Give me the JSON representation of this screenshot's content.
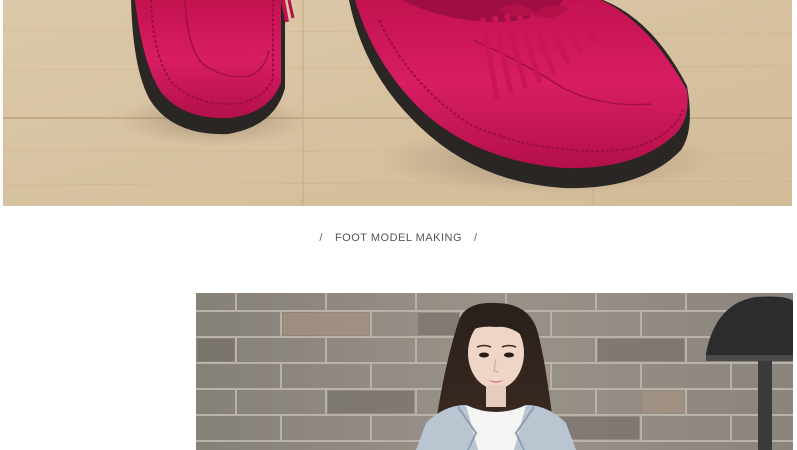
{
  "section": {
    "title": "FOOT MODEL MAKING",
    "left_mark": "/",
    "right_mark": "/"
  },
  "images": {
    "product_photo": "shoes-on-floor-photo",
    "model_photo": "model-brick-wall-photo"
  },
  "colors": {
    "shoe": "#d1185a",
    "shoe_dark": "#a80f45",
    "sole": "#2a2624",
    "floor": "#d8c3a2",
    "brick": "#8e8780",
    "text": "#555555"
  }
}
